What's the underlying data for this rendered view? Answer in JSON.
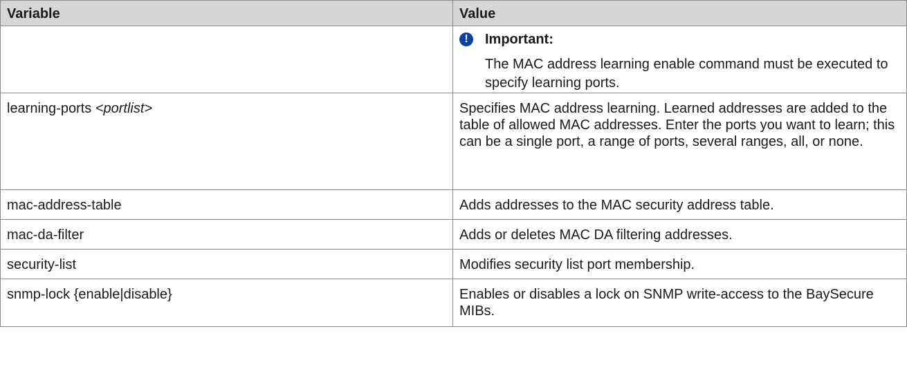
{
  "table": {
    "headers": {
      "variable": "Variable",
      "value": "Value"
    },
    "important_note": {
      "icon": "important-icon",
      "icon_glyph": "!",
      "icon_color": "#0b3fa3",
      "label": "Important:",
      "text": "The MAC address learning enable command must be executed to specify learning ports."
    },
    "rows": [
      {
        "variable_prefix": "learning-ports ",
        "variable_arg": "<portlist>",
        "value": "Specifies MAC address learning. Learned addresses are added to the table of allowed MAC addresses. Enter the ports you want to learn; this can be a single port, a range of ports, several ranges, all, or none."
      },
      {
        "variable_prefix": "mac-address-table",
        "variable_arg": "",
        "value": "Adds addresses to the MAC security address table."
      },
      {
        "variable_prefix": "mac-da-filter",
        "variable_arg": "",
        "value": "Adds or deletes MAC DA filtering addresses."
      },
      {
        "variable_prefix": "security-list",
        "variable_arg": "",
        "value": "Modifies security list port membership."
      },
      {
        "variable_prefix": "snmp-lock {enable|disable}",
        "variable_arg": "",
        "value": "Enables or disables a lock on SNMP write-access to the BaySecure MIBs."
      }
    ],
    "header_bg": "#d6d6d6",
    "border_color": "#8a8a8a"
  }
}
